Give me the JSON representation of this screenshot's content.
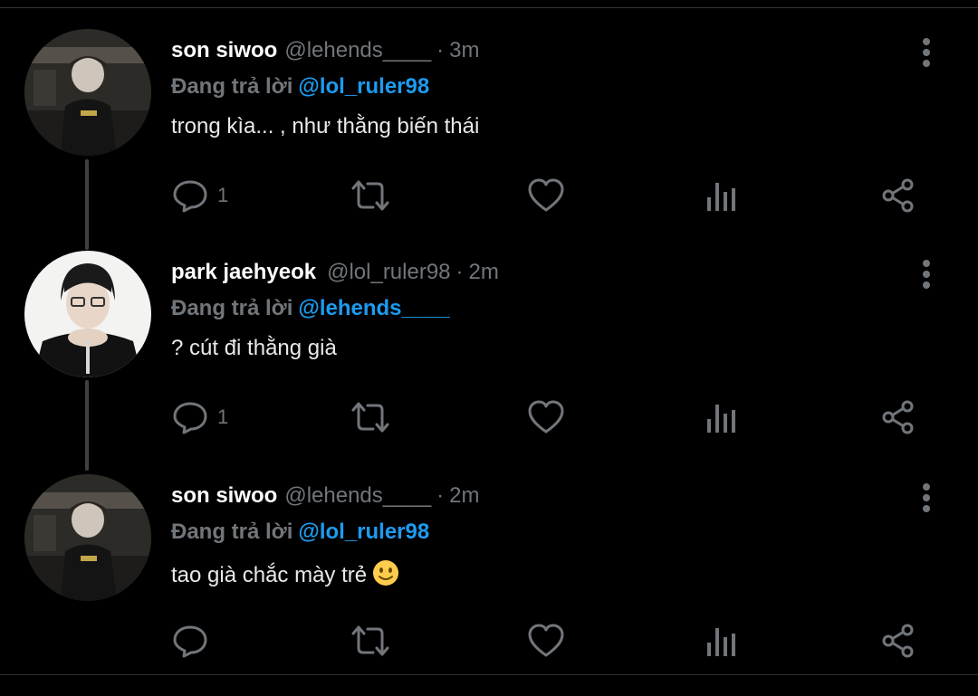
{
  "tweets": [
    {
      "name": "son siwoo",
      "handle": "@lehends____",
      "time": "3m",
      "reply_label": "Đang trả lời",
      "reply_to": "@lol_ruler98",
      "text": "trong kìa... , như thằng biến thái",
      "reply_count": "1",
      "emoji": ""
    },
    {
      "name": "park jaehyeok",
      "handle": "@lol_ruler98",
      "time": "2m",
      "reply_label": "Đang trả lời",
      "reply_to": "@lehends____",
      "text": "? cút đi thằng già",
      "reply_count": "1",
      "emoji": ""
    },
    {
      "name": "son siwoo",
      "handle": "@lehends____",
      "time": "2m",
      "reply_label": "Đang trả lời",
      "reply_to": "@lol_ruler98",
      "text": "tao già chắc mày trẻ",
      "reply_count": "",
      "emoji": "slightly-smiling-face"
    }
  ],
  "icons": {
    "reply": "reply-icon",
    "retweet": "retweet-icon",
    "like": "heart-icon",
    "views": "analytics-icon",
    "share": "share-icon",
    "more": "more-options-icon"
  },
  "colors": {
    "background": "#000000",
    "name": "#ffffff",
    "muted": "#71767b",
    "mention": "#1d9bf0",
    "thread_line": "#3e4144"
  },
  "dot_separator": "·"
}
